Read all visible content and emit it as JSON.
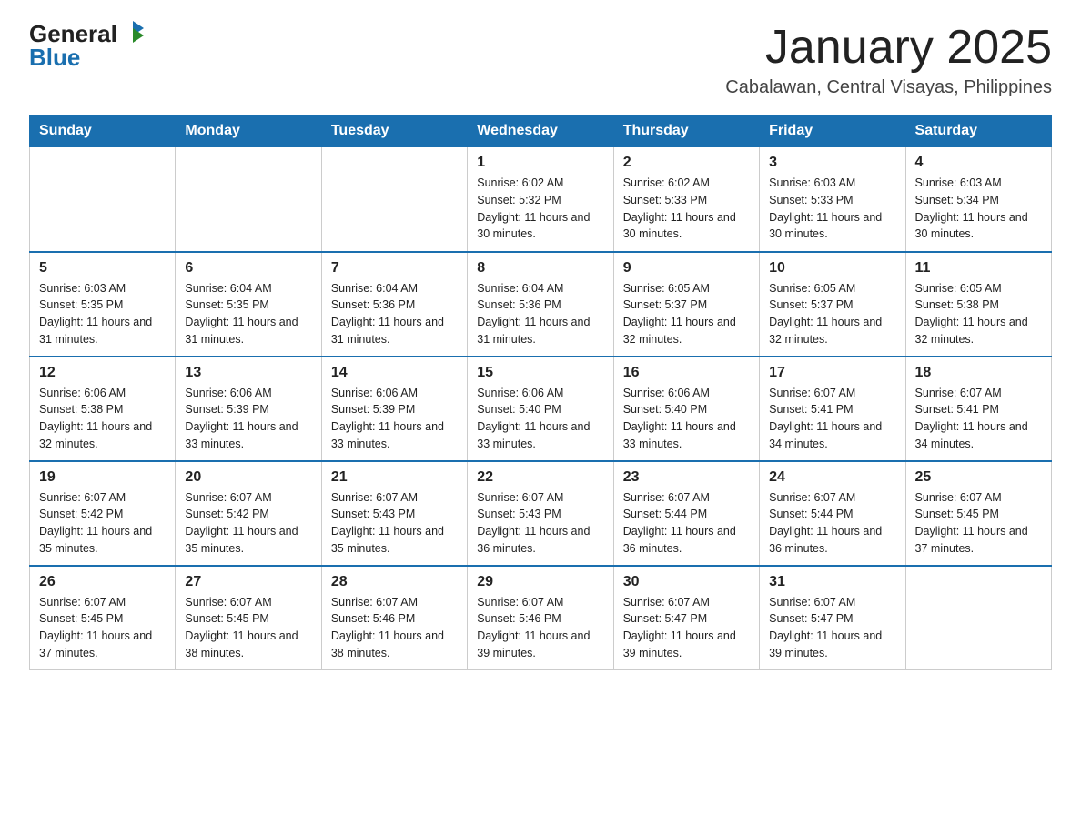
{
  "logo": {
    "general": "General",
    "blue": "Blue"
  },
  "title": "January 2025",
  "subtitle": "Cabalawan, Central Visayas, Philippines",
  "headers": [
    "Sunday",
    "Monday",
    "Tuesday",
    "Wednesday",
    "Thursday",
    "Friday",
    "Saturday"
  ],
  "weeks": [
    [
      {
        "day": "",
        "info": ""
      },
      {
        "day": "",
        "info": ""
      },
      {
        "day": "",
        "info": ""
      },
      {
        "day": "1",
        "info": "Sunrise: 6:02 AM\nSunset: 5:32 PM\nDaylight: 11 hours\nand 30 minutes."
      },
      {
        "day": "2",
        "info": "Sunrise: 6:02 AM\nSunset: 5:33 PM\nDaylight: 11 hours\nand 30 minutes."
      },
      {
        "day": "3",
        "info": "Sunrise: 6:03 AM\nSunset: 5:33 PM\nDaylight: 11 hours\nand 30 minutes."
      },
      {
        "day": "4",
        "info": "Sunrise: 6:03 AM\nSunset: 5:34 PM\nDaylight: 11 hours\nand 30 minutes."
      }
    ],
    [
      {
        "day": "5",
        "info": "Sunrise: 6:03 AM\nSunset: 5:35 PM\nDaylight: 11 hours\nand 31 minutes."
      },
      {
        "day": "6",
        "info": "Sunrise: 6:04 AM\nSunset: 5:35 PM\nDaylight: 11 hours\nand 31 minutes."
      },
      {
        "day": "7",
        "info": "Sunrise: 6:04 AM\nSunset: 5:36 PM\nDaylight: 11 hours\nand 31 minutes."
      },
      {
        "day": "8",
        "info": "Sunrise: 6:04 AM\nSunset: 5:36 PM\nDaylight: 11 hours\nand 31 minutes."
      },
      {
        "day": "9",
        "info": "Sunrise: 6:05 AM\nSunset: 5:37 PM\nDaylight: 11 hours\nand 32 minutes."
      },
      {
        "day": "10",
        "info": "Sunrise: 6:05 AM\nSunset: 5:37 PM\nDaylight: 11 hours\nand 32 minutes."
      },
      {
        "day": "11",
        "info": "Sunrise: 6:05 AM\nSunset: 5:38 PM\nDaylight: 11 hours\nand 32 minutes."
      }
    ],
    [
      {
        "day": "12",
        "info": "Sunrise: 6:06 AM\nSunset: 5:38 PM\nDaylight: 11 hours\nand 32 minutes."
      },
      {
        "day": "13",
        "info": "Sunrise: 6:06 AM\nSunset: 5:39 PM\nDaylight: 11 hours\nand 33 minutes."
      },
      {
        "day": "14",
        "info": "Sunrise: 6:06 AM\nSunset: 5:39 PM\nDaylight: 11 hours\nand 33 minutes."
      },
      {
        "day": "15",
        "info": "Sunrise: 6:06 AM\nSunset: 5:40 PM\nDaylight: 11 hours\nand 33 minutes."
      },
      {
        "day": "16",
        "info": "Sunrise: 6:06 AM\nSunset: 5:40 PM\nDaylight: 11 hours\nand 33 minutes."
      },
      {
        "day": "17",
        "info": "Sunrise: 6:07 AM\nSunset: 5:41 PM\nDaylight: 11 hours\nand 34 minutes."
      },
      {
        "day": "18",
        "info": "Sunrise: 6:07 AM\nSunset: 5:41 PM\nDaylight: 11 hours\nand 34 minutes."
      }
    ],
    [
      {
        "day": "19",
        "info": "Sunrise: 6:07 AM\nSunset: 5:42 PM\nDaylight: 11 hours\nand 35 minutes."
      },
      {
        "day": "20",
        "info": "Sunrise: 6:07 AM\nSunset: 5:42 PM\nDaylight: 11 hours\nand 35 minutes."
      },
      {
        "day": "21",
        "info": "Sunrise: 6:07 AM\nSunset: 5:43 PM\nDaylight: 11 hours\nand 35 minutes."
      },
      {
        "day": "22",
        "info": "Sunrise: 6:07 AM\nSunset: 5:43 PM\nDaylight: 11 hours\nand 36 minutes."
      },
      {
        "day": "23",
        "info": "Sunrise: 6:07 AM\nSunset: 5:44 PM\nDaylight: 11 hours\nand 36 minutes."
      },
      {
        "day": "24",
        "info": "Sunrise: 6:07 AM\nSunset: 5:44 PM\nDaylight: 11 hours\nand 36 minutes."
      },
      {
        "day": "25",
        "info": "Sunrise: 6:07 AM\nSunset: 5:45 PM\nDaylight: 11 hours\nand 37 minutes."
      }
    ],
    [
      {
        "day": "26",
        "info": "Sunrise: 6:07 AM\nSunset: 5:45 PM\nDaylight: 11 hours\nand 37 minutes."
      },
      {
        "day": "27",
        "info": "Sunrise: 6:07 AM\nSunset: 5:45 PM\nDaylight: 11 hours\nand 38 minutes."
      },
      {
        "day": "28",
        "info": "Sunrise: 6:07 AM\nSunset: 5:46 PM\nDaylight: 11 hours\nand 38 minutes."
      },
      {
        "day": "29",
        "info": "Sunrise: 6:07 AM\nSunset: 5:46 PM\nDaylight: 11 hours\nand 39 minutes."
      },
      {
        "day": "30",
        "info": "Sunrise: 6:07 AM\nSunset: 5:47 PM\nDaylight: 11 hours\nand 39 minutes."
      },
      {
        "day": "31",
        "info": "Sunrise: 6:07 AM\nSunset: 5:47 PM\nDaylight: 11 hours\nand 39 minutes."
      },
      {
        "day": "",
        "info": ""
      }
    ]
  ]
}
